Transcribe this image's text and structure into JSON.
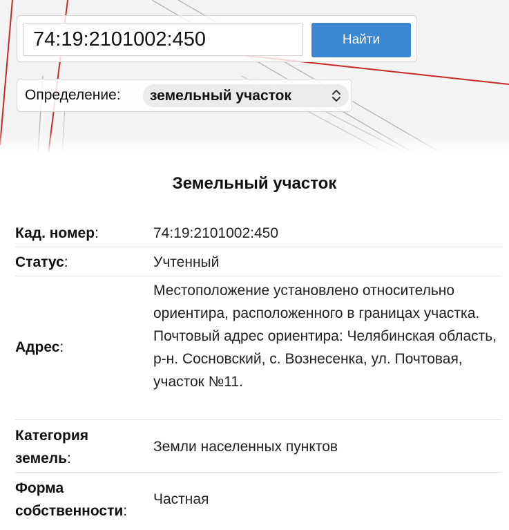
{
  "search": {
    "value": "74:19:2101002:450",
    "button_label": "Найти"
  },
  "definition": {
    "label": "Определение:",
    "selected": "земельный участок"
  },
  "card": {
    "title": "Земельный участок",
    "rows": [
      {
        "label": "Кад. номер",
        "value": "74:19:2101002:450"
      },
      {
        "label": "Статус",
        "value": "Учтенный"
      },
      {
        "label": "Адрес",
        "value": "Местоположение установлено относительно ориентира, расположенного в границах участка. Почтовый адрес ориентира: Челябинская область, р-н. Сосновский, с. Вознесенка, ул. Почтовая, участок №11."
      },
      {
        "label_line1": "Категория",
        "label_line2": "земель",
        "value": "Земли населенных пунктов"
      },
      {
        "label_line1": "Форма",
        "label_line2": "собственности",
        "value": "Частная"
      }
    ]
  },
  "colors": {
    "button_bg": "#3b87d1",
    "boundary_line": "#c62828"
  }
}
